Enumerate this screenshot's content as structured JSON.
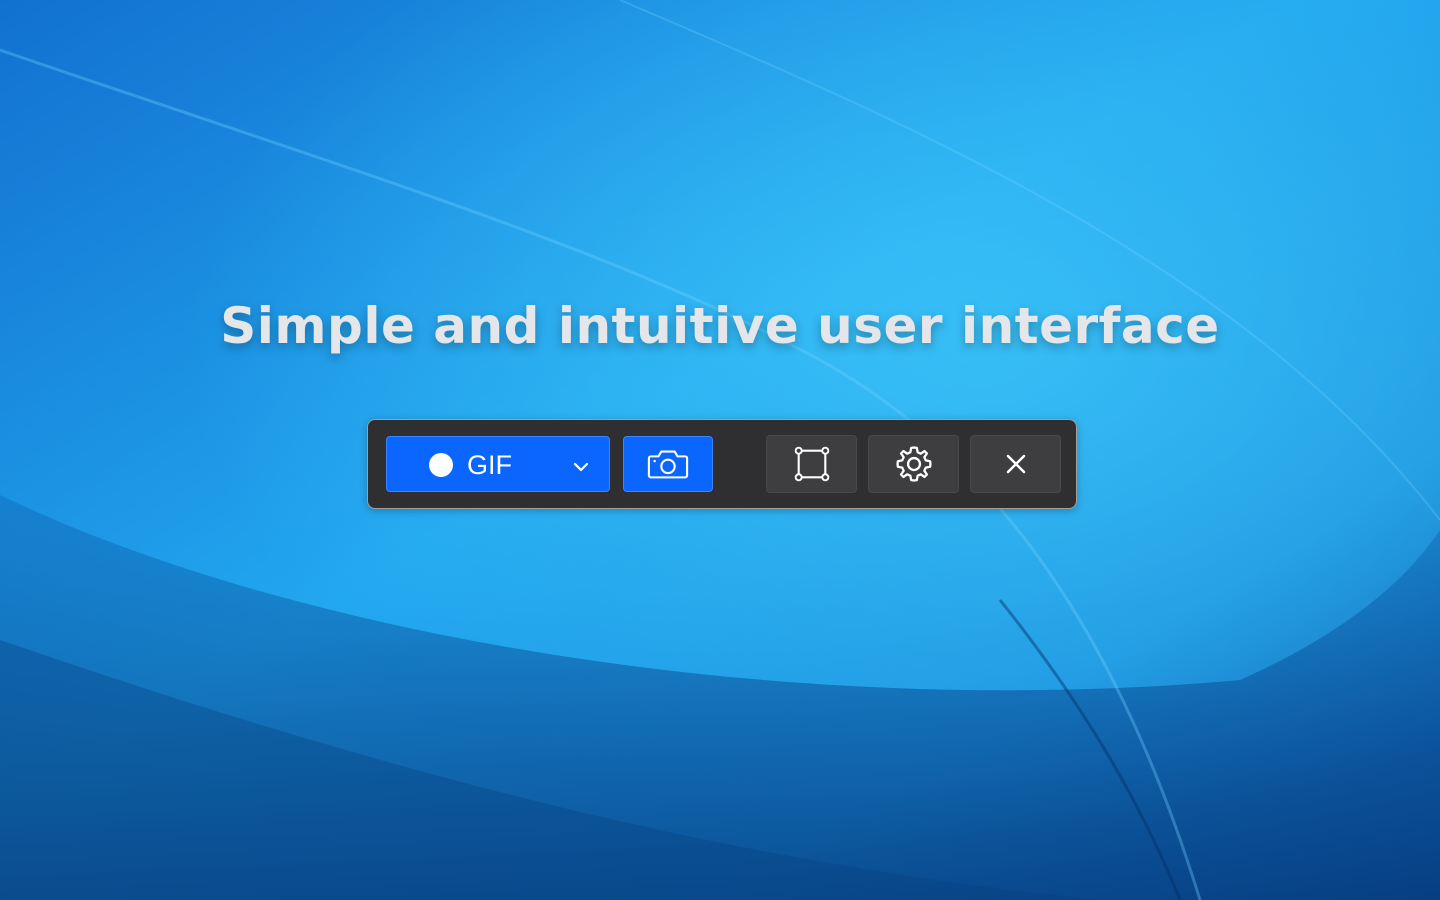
{
  "headline": "Simple and intuitive user interface",
  "toolbar": {
    "record_button": {
      "label": "GIF",
      "icon": "record-dot-icon",
      "dropdown_icon": "chevron-down-icon"
    },
    "screenshot_button": {
      "icon": "camera-icon"
    },
    "area_button": {
      "icon": "crop-area-icon"
    },
    "settings_button": {
      "icon": "gear-icon"
    },
    "close_button": {
      "icon": "close-icon"
    }
  },
  "colors": {
    "accent": "#0a66ff",
    "toolbar_bg": "#2f2f31",
    "button_dark": "#3e3e40",
    "headline": "#e4e6ea",
    "wallpaper": "#1a8fe0"
  }
}
